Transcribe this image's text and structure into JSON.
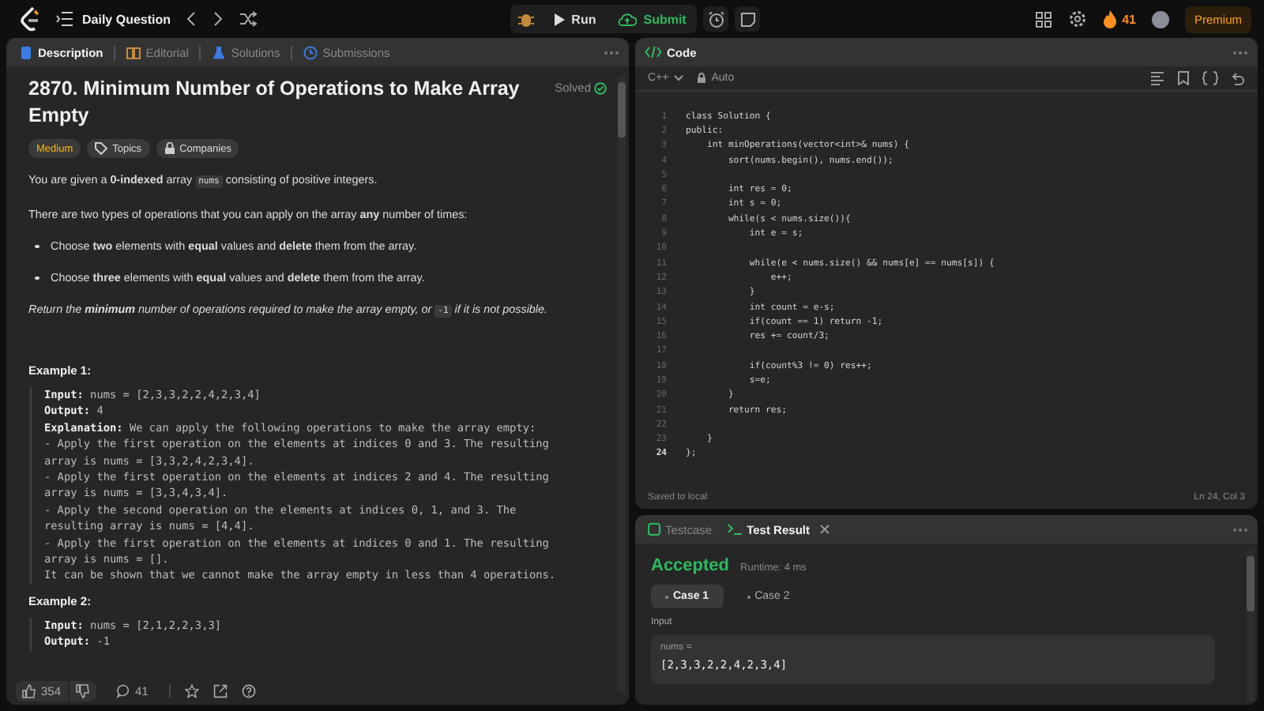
{
  "topbar": {
    "title": "Daily Question",
    "run": "Run",
    "submit": "Submit",
    "streak": "41",
    "premium": "Premium"
  },
  "left_tabs": [
    {
      "label": "Description",
      "selected": true
    },
    {
      "label": "Editorial",
      "selected": false
    },
    {
      "label": "Solutions",
      "selected": false
    },
    {
      "label": "Submissions",
      "selected": false
    }
  ],
  "problem": {
    "title": "2870. Minimum Number of Operations to Make Array Empty",
    "status": "Solved",
    "difficulty": "Medium",
    "tags": [
      "Topics",
      "Companies"
    ],
    "paragraphs": [
      {
        "kind": "text",
        "parts": [
          {
            "kind": "text",
            "text": "You are given a **0-indexed** array "
          },
          {
            "kind": "code",
            "text": "nums"
          },
          {
            "kind": "text",
            "text": " consisting of positive integers."
          }
        ]
      },
      {
        "kind": "text",
        "parts": [
          {
            "kind": "text",
            "text": "There are two types of operations that you can apply on the array **any** number of times:"
          }
        ]
      },
      {
        "kind": "bullet",
        "parts": [
          {
            "kind": "text",
            "text": "Choose **two** elements with **equal** values and **delete** them from the array."
          }
        ]
      },
      {
        "kind": "bullet",
        "parts": [
          {
            "kind": "text",
            "text": "Choose **three** elements with **equal** values and **delete** them from the array."
          }
        ]
      },
      {
        "kind": "italic",
        "parts": [
          {
            "kind": "text",
            "text": "Return the **minimum** number of operations required to make the array empty, or "
          },
          {
            "kind": "code",
            "text": "-1"
          },
          {
            "kind": "text",
            "text": " if it is not possible."
          }
        ]
      }
    ],
    "examples": [
      {
        "title": "Example 1:",
        "lines": [
          "**Input:** nums = [2,3,3,2,2,4,2,3,4]",
          "**Output:** 4",
          "**Explanation:** We can apply the following operations to make the array empty:",
          "- Apply the first operation on the elements at indices 0 and 3. The resulting",
          "array is nums = [3,3,2,4,2,3,4].",
          "- Apply the first operation on the elements at indices 2 and 4. The resulting",
          "array is nums = [3,3,4,3,4].",
          "- Apply the second operation on the elements at indices 0, 1, and 3. The",
          "resulting array is nums = [4,4].",
          "- Apply the first operation on the elements at indices 0 and 1. The resulting",
          "array is nums = [].",
          "It can be shown that we cannot make the array empty in less than 4 operations."
        ]
      },
      {
        "title": "Example 2:",
        "lines": [
          "**Input:** nums = [2,1,2,2,3,3]",
          "**Output:** -1"
        ]
      }
    ],
    "likes": "354",
    "comments": "41"
  },
  "code": {
    "title": "Code",
    "language": "C++",
    "mode": "Auto",
    "saved": "Saved to local",
    "cursor": "Ln 24, Col 3",
    "lines": [
      {
        "n": "1",
        "text": "class Solution {",
        "current": false
      },
      {
        "n": "2",
        "text": "public:",
        "current": false
      },
      {
        "n": "3",
        "text": "    int minOperations(vector<int>& nums) {",
        "current": false
      },
      {
        "n": "4",
        "text": "        sort(nums.begin(), nums.end());",
        "current": false
      },
      {
        "n": "5",
        "current": false
      },
      {
        "n": "6",
        "text": "        int res = 0;",
        "current": false
      },
      {
        "n": "7",
        "text": "        int s = 0;",
        "current": false
      },
      {
        "n": "8",
        "text": "        while(s < nums.size()){",
        "current": false
      },
      {
        "n": "9",
        "text": "            int e = s;",
        "current": false
      },
      {
        "n": "10",
        "current": false
      },
      {
        "n": "11",
        "text": "            while(e < nums.size() && nums[e] == nums[s]) {",
        "current": false
      },
      {
        "n": "12",
        "text": "                e++;",
        "current": false
      },
      {
        "n": "13",
        "text": "            }",
        "current": false
      },
      {
        "n": "14",
        "text": "            int count = e-s;",
        "current": false
      },
      {
        "n": "15",
        "text": "            if(count == 1) return -1;",
        "current": false
      },
      {
        "n": "16",
        "text": "            res += count/3;",
        "current": false
      },
      {
        "n": "17",
        "current": false
      },
      {
        "n": "18",
        "text": "            if(count%3 != 0) res++;",
        "current": false
      },
      {
        "n": "19",
        "text": "            s=e;",
        "current": false
      },
      {
        "n": "20",
        "text": "        }",
        "current": false
      },
      {
        "n": "21",
        "text": "        return res;",
        "current": false
      },
      {
        "n": "22",
        "current": false
      },
      {
        "n": "23",
        "text": "    }",
        "current": false
      },
      {
        "n": "24",
        "text": "};",
        "current": true
      }
    ]
  },
  "test_tabs": [
    {
      "label": "Testcase",
      "selected": false
    },
    {
      "label": "Test Result",
      "selected": true
    }
  ],
  "result": {
    "verdict": "Accepted",
    "runtime": "Runtime: 4 ms",
    "cases": [
      {
        "label": "Case 1",
        "selected": true
      },
      {
        "label": "Case 2",
        "selected": false
      }
    ],
    "input_label": "Input",
    "var_name": "nums =",
    "var_value": "[2,3,3,2,2,4,2,3,4]"
  }
}
